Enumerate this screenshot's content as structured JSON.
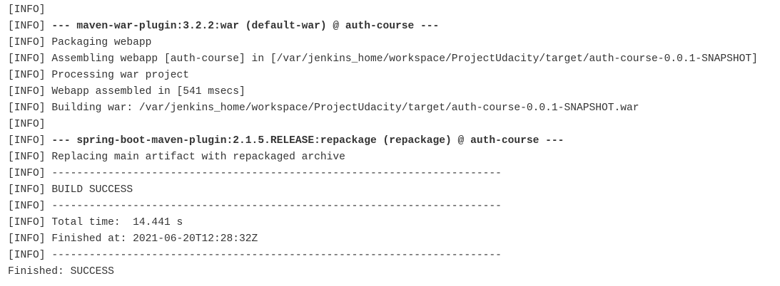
{
  "console": {
    "lines": [
      {
        "prefix": "[INFO]",
        "text": "",
        "bold": false
      },
      {
        "prefix": "[INFO]",
        "text": "--- maven-war-plugin:3.2.2:war (default-war) @ auth-course ---",
        "bold": true
      },
      {
        "prefix": "[INFO]",
        "text": "Packaging webapp",
        "bold": false
      },
      {
        "prefix": "[INFO]",
        "text": "Assembling webapp [auth-course] in [/var/jenkins_home/workspace/ProjectUdacity/target/auth-course-0.0.1-SNAPSHOT]",
        "bold": false
      },
      {
        "prefix": "[INFO]",
        "text": "Processing war project",
        "bold": false
      },
      {
        "prefix": "[INFO]",
        "text": "Webapp assembled in [541 msecs]",
        "bold": false
      },
      {
        "prefix": "[INFO]",
        "text": "Building war: /var/jenkins_home/workspace/ProjectUdacity/target/auth-course-0.0.1-SNAPSHOT.war",
        "bold": false
      },
      {
        "prefix": "[INFO]",
        "text": "",
        "bold": false
      },
      {
        "prefix": "[INFO]",
        "text": "--- spring-boot-maven-plugin:2.1.5.RELEASE:repackage (repackage) @ auth-course ---",
        "bold": true
      },
      {
        "prefix": "[INFO]",
        "text": "Replacing main artifact with repackaged archive",
        "bold": false
      },
      {
        "prefix": "[INFO]",
        "text": "------------------------------------------------------------------------",
        "bold": false
      },
      {
        "prefix": "[INFO]",
        "text": "BUILD SUCCESS",
        "bold": false
      },
      {
        "prefix": "[INFO]",
        "text": "------------------------------------------------------------------------",
        "bold": false
      },
      {
        "prefix": "[INFO]",
        "text": "Total time:  14.441 s",
        "bold": false
      },
      {
        "prefix": "[INFO]",
        "text": "Finished at: 2021-06-20T12:28:32Z",
        "bold": false
      },
      {
        "prefix": "[INFO]",
        "text": "------------------------------------------------------------------------",
        "bold": false
      }
    ],
    "final_status": "Finished: SUCCESS"
  }
}
